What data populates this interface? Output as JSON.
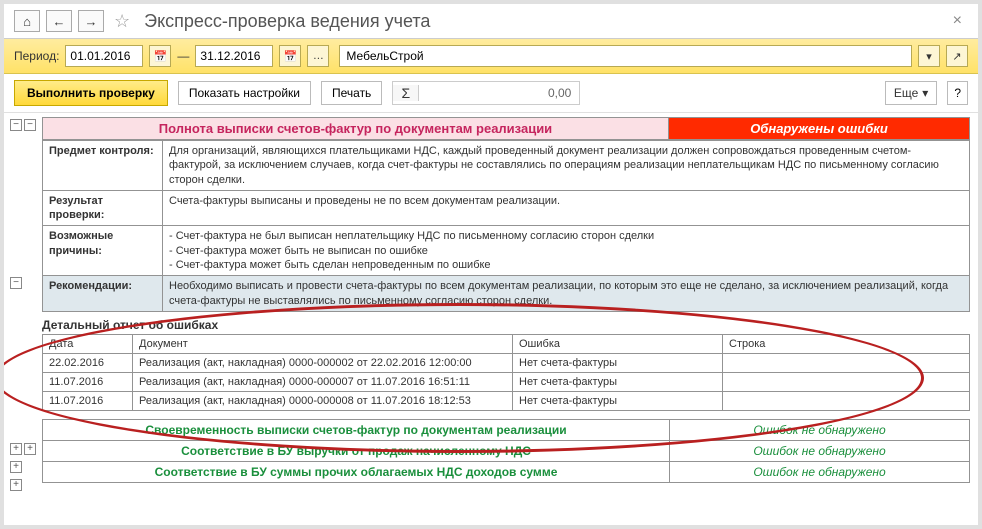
{
  "title": "Экспресс-проверка ведения учета",
  "period": {
    "label": "Период:",
    "from": "01.01.2016",
    "to": "31.12.2016",
    "sep": "—"
  },
  "org": "МебельСтрой",
  "toolbar": {
    "run": "Выполнить проверку",
    "settings": "Показать настройки",
    "print": "Печать",
    "sigma": "Σ",
    "sigma_val": "0,00",
    "more": "Еще"
  },
  "section": {
    "title": "Полнота выписки счетов-фактур по документам реализации",
    "status": "Обнаружены ошибки"
  },
  "info": {
    "subject_lbl": "Предмет контроля:",
    "subject_val": "Для организаций, являющихся плательщиками НДС, каждый проведенный документ реализации должен сопровождаться проведенным счетом-фактурой, за исключением случаев, когда счет-фактуры не составлялись по операциям реализации неплательщикам НДС по письменному согласию сторон сделки.",
    "result_lbl": "Результат проверки:",
    "result_val": "Счета-фактуры выписаны и проведены не по всем документам реализации.",
    "cause_lbl": "Возможные причины:",
    "cause_val": "- Счет-фактура не был выписан неплательщику НДС по письменному согласию сторон сделки\n- Счет-фактура может быть не выписан по ошибке\n- Счет-фактура может быть сделан непроведенным по ошибке",
    "rec_lbl": "Рекомендации:",
    "rec_val": "Необходимо выписать и провести счета-фактуры по всем документам реализации, по которым это еще не сделано, за исключением реализаций, когда счета-фактуры не выставлялись по письменному согласию сторон сделки."
  },
  "detail": {
    "title": "Детальный отчет об ошибках",
    "cols": {
      "date": "Дата",
      "doc": "Документ",
      "err": "Ошибка",
      "row": "Строка"
    },
    "rows": [
      {
        "date": "22.02.2016",
        "doc": "Реализация (акт, накладная) 0000-000002 от 22.02.2016 12:00:00",
        "err": "Нет счета-фактуры",
        "row": ""
      },
      {
        "date": "11.07.2016",
        "doc": "Реализация (акт, накладная) 0000-000007 от 11.07.2016 16:51:11",
        "err": "Нет счета-фактуры",
        "row": ""
      },
      {
        "date": "11.07.2016",
        "doc": "Реализация (акт, накладная) 0000-000008 от 11.07.2016 18:12:53",
        "err": "Нет счета-фактуры",
        "row": ""
      }
    ]
  },
  "summary": {
    "ok": "Ошибок не обнаружено",
    "rows": [
      "Своевременность выписки счетов-фактур по документам реализации",
      "Соответствие в БУ выручки от продаж начисленному НДС",
      "Соответствие в БУ суммы прочих облагаемых НДС доходов сумме"
    ]
  }
}
